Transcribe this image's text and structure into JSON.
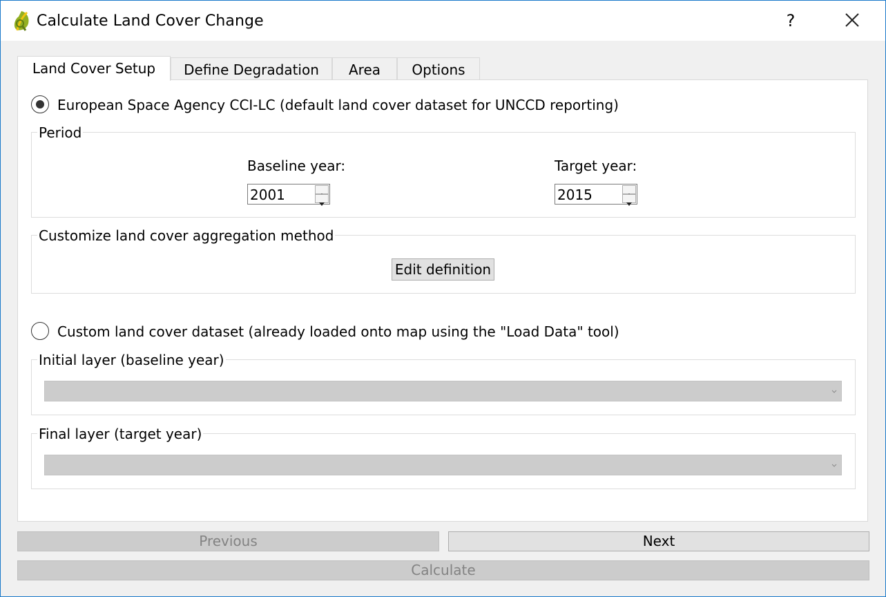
{
  "window": {
    "title": "Calculate Land Cover Change",
    "help_label": "?"
  },
  "tabs": [
    {
      "label": "Land Cover Setup"
    },
    {
      "label": "Define Degradation"
    },
    {
      "label": "Area"
    },
    {
      "label": "Options"
    }
  ],
  "esa": {
    "radio_label": "European Space Agency CCI-LC (default land cover dataset for UNCCD reporting)",
    "selected": true
  },
  "period": {
    "title": "Period",
    "baseline_label": "Baseline year:",
    "baseline_value": "2001",
    "target_label": "Target year:",
    "target_value": "2015"
  },
  "aggregation": {
    "title": "Customize land cover aggregation method",
    "edit_button": "Edit definition"
  },
  "custom": {
    "radio_label": "Custom land cover dataset (already loaded onto map using the \"Load Data\" tool)",
    "selected": false,
    "initial_title": "Initial layer (baseline year)",
    "initial_value": "",
    "final_title": "Final layer (target year)",
    "final_value": ""
  },
  "footer": {
    "previous": "Previous",
    "next": "Next",
    "calculate": "Calculate"
  }
}
